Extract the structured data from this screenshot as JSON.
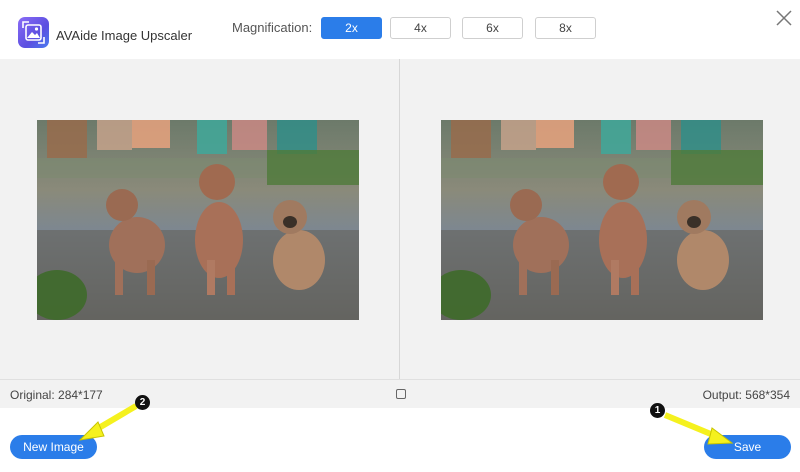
{
  "app": {
    "title": "AVAide Image Upscaler",
    "icon": "image-upscaler-logo-icon",
    "accent": "#2b7de9"
  },
  "magnification": {
    "label": "Magnification:",
    "options": [
      "2x",
      "4x",
      "6x",
      "8x"
    ],
    "selected": "2x"
  },
  "window": {
    "close_icon": "close-icon"
  },
  "preview": {
    "original_image": "puppies-photo-original",
    "output_image": "puppies-photo-output"
  },
  "status": {
    "original_label": "Original: 284*177",
    "output_label": "Output: 568*354"
  },
  "footer": {
    "new_image_label": "New Image",
    "save_label": "Save"
  },
  "annotations": {
    "badge_1": "1",
    "badge_2": "2",
    "arrow_color": "#f5f11e"
  }
}
